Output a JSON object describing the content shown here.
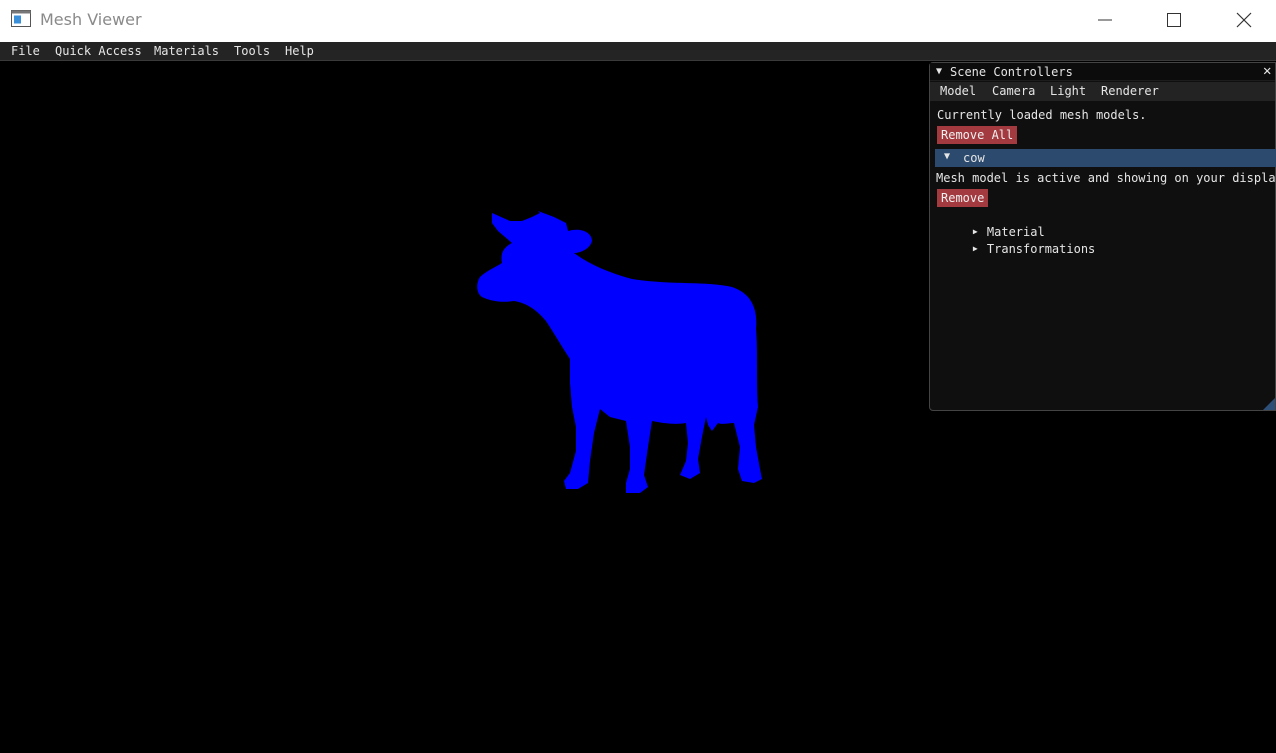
{
  "window": {
    "title": "Mesh Viewer",
    "icon": "app-window-icon",
    "controls": [
      "minimize-icon",
      "maximize-icon",
      "close-icon"
    ]
  },
  "menubar": {
    "items": [
      "File",
      "Quick Access",
      "Materials",
      "Tools",
      "Help"
    ]
  },
  "viewport": {
    "model_name": "cow",
    "model_color": "#0000ff",
    "background": "#000000"
  },
  "panel": {
    "title": "Scene Controllers",
    "collapse_icon": "triangle-down-icon",
    "close_icon": "close-icon",
    "tabs": [
      "Model",
      "Camera",
      "Light",
      "Renderer"
    ],
    "loaded_text": "Currently loaded mesh models.",
    "remove_all_label": "Remove All",
    "model": {
      "name": "cow",
      "status_text": "Mesh model is active and showing on your display",
      "remove_label": "Remove",
      "children": [
        "Material",
        "Transformations"
      ]
    },
    "accent_button_color": "#a33a3f",
    "header_color": "#2b4a6d"
  }
}
